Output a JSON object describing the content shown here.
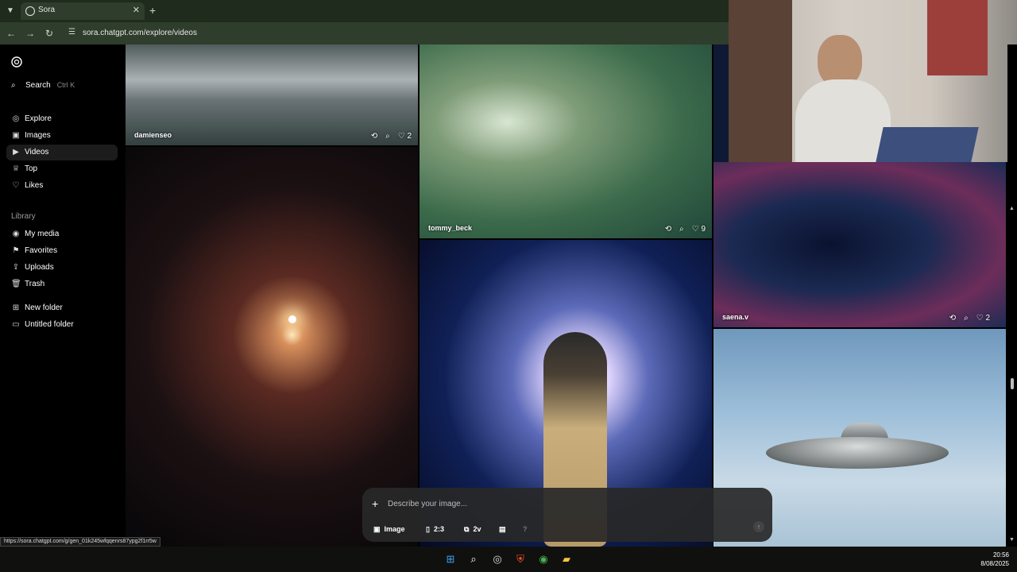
{
  "browser": {
    "tab_title": "Sora",
    "url": "sora.chatgpt.com/explore/videos",
    "status_url": "https://sora.chatgpt.com/g/gen_01k245wfqqenrs87ypg2f1rr5w"
  },
  "sidebar": {
    "search_label": "Search",
    "search_shortcut": "Ctrl K",
    "nav": [
      {
        "label": "Explore",
        "icon": "compass-icon"
      },
      {
        "label": "Images",
        "icon": "image-icon"
      },
      {
        "label": "Videos",
        "icon": "video-icon",
        "active": true
      },
      {
        "label": "Top",
        "icon": "trophy-icon"
      },
      {
        "label": "Likes",
        "icon": "heart-icon"
      }
    ],
    "library_label": "Library",
    "library": [
      {
        "label": "My media",
        "icon": "media-icon"
      },
      {
        "label": "Favorites",
        "icon": "bookmark-icon"
      },
      {
        "label": "Uploads",
        "icon": "upload-icon"
      },
      {
        "label": "Trash",
        "icon": "trash-icon"
      }
    ],
    "folders": [
      {
        "label": "New folder",
        "icon": "folder-plus-icon"
      },
      {
        "label": "Untitled folder",
        "icon": "folder-icon"
      }
    ]
  },
  "tiles": [
    {
      "author": "damienseo",
      "likes": "2"
    },
    {
      "author": "tommy_beck",
      "likes": "9"
    },
    {
      "author": "saena.v",
      "likes": "2"
    }
  ],
  "composer": {
    "placeholder": "Describe your image...",
    "type_label": "Image",
    "aspect_label": "2:3",
    "variations_label": "2v"
  },
  "taskbar": {
    "time": "20:56",
    "date": "8/08/2025"
  },
  "colors": {
    "chrome_bg": "#2f3d2c",
    "sidebar_active": "#1c1c1c"
  }
}
